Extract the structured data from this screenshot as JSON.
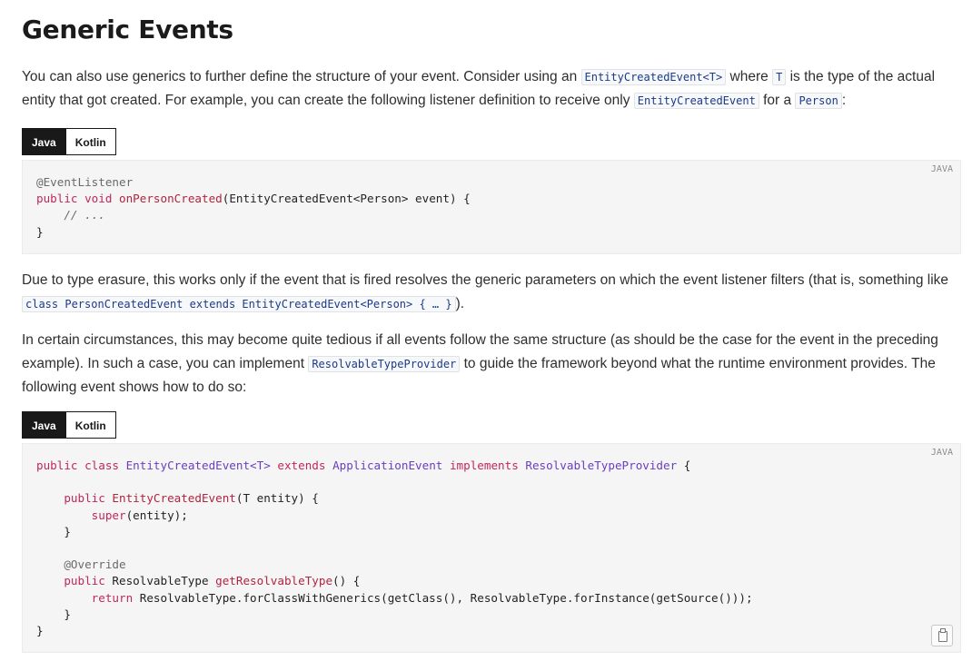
{
  "heading": "Generic Events",
  "para1": {
    "t1": "You can also use generics to further define the structure of your event. Consider using an ",
    "c1": "EntityCreatedEvent<T>",
    "t2": " where ",
    "c2": "T",
    "t3": " is the type of the actual entity that got created. For example, you can create the following listener definition to receive only ",
    "c3": "EntityCreatedEvent",
    "t4": " for a ",
    "c4": "Person",
    "t5": ":"
  },
  "tabs1": {
    "java": "Java",
    "kotlin": "Kotlin"
  },
  "code1": {
    "lang": "JAVA",
    "l1_annotation": "@EventListener",
    "l2_kw": "public void ",
    "l2_fn": "onPersonCreated",
    "l2_rest": "(EntityCreatedEvent<Person> event) {",
    "l3_comment": "    // ...",
    "l4": "}"
  },
  "para2": {
    "t1": "Due to type erasure, this works only if the event that is fired resolves the generic parameters on which the event listener filters (that is, something like ",
    "c1": "class PersonCreatedEvent extends EntityCreatedEvent<Person> { … }",
    "t2": ")."
  },
  "para3": {
    "t1": "In certain circumstances, this may become quite tedious if all events follow the same structure (as should be the case for the event in the preceding example). In such a case, you can implement ",
    "c1": "ResolvableTypeProvider",
    "t2": " to guide the framework beyond what the runtime environment provides. The following event shows how to do so:"
  },
  "tabs2": {
    "java": "Java",
    "kotlin": "Kotlin"
  },
  "code2": {
    "lang": "JAVA",
    "l1_kw1": "public class ",
    "l1_ty1": "EntityCreatedEvent<T> ",
    "l1_kw2": "extends ",
    "l1_ty2": "ApplicationEvent ",
    "l1_kw3": "implements ",
    "l1_ty3": "ResolvableTypeProvider",
    "l1_rest": " {",
    "l3_kw": "    public ",
    "l3_fn": "EntityCreatedEvent",
    "l3_rest": "(T entity) {",
    "l4_kw": "        super",
    "l4_rest": "(entity);",
    "l5": "    }",
    "l7_annotation": "    @Override",
    "l8_kw": "    public ",
    "l8_mid": "ResolvableType ",
    "l8_fn": "getResolvableType",
    "l8_rest": "() {",
    "l9_kw": "        return ",
    "l9_rest": "ResolvableType.forClassWithGenerics(getClass(), ResolvableType.forInstance(getSource()));",
    "l10": "    }",
    "l11": "}"
  }
}
